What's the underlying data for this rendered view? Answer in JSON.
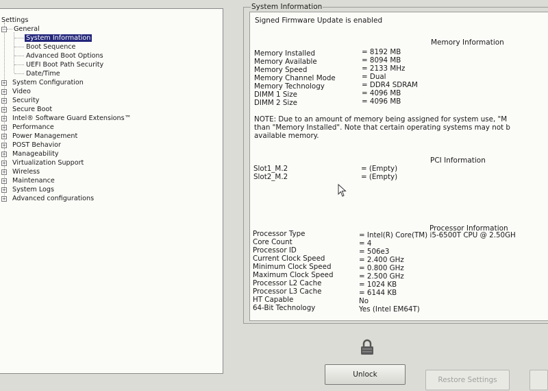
{
  "tree": {
    "root": "Settings",
    "general": {
      "label": "General",
      "children": [
        "System Information",
        "Boot Sequence",
        "Advanced Boot Options",
        "UEFI Boot Path Security",
        "Date/Time"
      ]
    },
    "categories": [
      "System Configuration",
      "Video",
      "Security",
      "Secure Boot",
      "Intel® Software Guard Extensions™",
      "Performance",
      "Power Management",
      "POST Behavior",
      "Manageability",
      "Virtualization Support",
      "Wireless",
      "Maintenance",
      "System Logs",
      "Advanced configurations"
    ]
  },
  "info": {
    "group_title": "System Information",
    "firmware_notice": "Signed Firmware Update is enabled",
    "memory": {
      "heading": "Memory Information",
      "rows": [
        {
          "label": "Memory Installed",
          "value": "= 8192 MB"
        },
        {
          "label": "Memory Available",
          "value": "= 8094 MB"
        },
        {
          "label": "Memory Speed",
          "value": "= 2133 MHz"
        },
        {
          "label": "Memory Channel Mode",
          "value": "= Dual"
        },
        {
          "label": "Memory Technology",
          "value": "= DDR4 SDRAM"
        },
        {
          "label": "DIMM 1 Size",
          "value": "= 4096 MB"
        },
        {
          "label": "DIMM 2 Size",
          "value": "= 4096 MB"
        }
      ],
      "note_lines": [
        "NOTE: Due to an amount of memory being assigned for system use, \"M",
        "than \"Memory Installed\". Note that certain operating systems may not b",
        "available memory."
      ]
    },
    "pci": {
      "heading": "PCI Information",
      "rows": [
        {
          "label": "Slot1_M.2",
          "value": "= (Empty)"
        },
        {
          "label": "Slot2_M.2",
          "value": "= (Empty)"
        }
      ]
    },
    "processor": {
      "heading": "Processor Information",
      "rows": [
        {
          "label": "Processor Type",
          "value": "= Intel(R) Core(TM) i5-6500T CPU @ 2.50GH"
        },
        {
          "label": "Core Count",
          "value": "= 4"
        },
        {
          "label": "Processor ID",
          "value": "= 506e3"
        },
        {
          "label": "Current Clock Speed",
          "value": "= 2.400 GHz"
        },
        {
          "label": "Minimum Clock Speed",
          "value": "= 0.800 GHz"
        },
        {
          "label": "Maximum Clock Speed",
          "value": "= 2.500 GHz"
        },
        {
          "label": "Processor L2 Cache",
          "value": "= 1024 KB"
        },
        {
          "label": "Processor L3 Cache",
          "value": "= 6144 KB"
        },
        {
          "label": "HT Capable",
          "value": "No"
        },
        {
          "label": "64-Bit Technology",
          "value": "Yes (Intel EM64T)"
        }
      ]
    }
  },
  "buttons": {
    "unlock": "Unlock",
    "restore": "Restore Settings"
  },
  "icons": {
    "lock": "lock-icon",
    "cursor": "mouse-pointer-icon"
  },
  "colors": {
    "selection": "#23267a",
    "panel": "#fbfbf8",
    "background": "#dcdcd6"
  }
}
